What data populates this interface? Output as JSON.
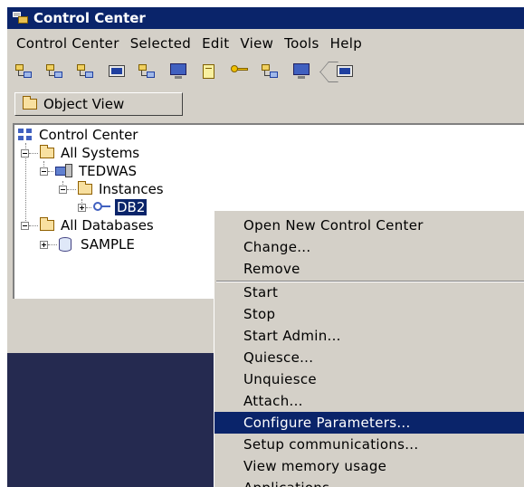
{
  "window": {
    "title": "Control Center"
  },
  "menubar": {
    "items": [
      "Control Center",
      "Selected",
      "Edit",
      "View",
      "Tools",
      "Help"
    ]
  },
  "toolbar": {
    "icons": [
      "system-tree-icon",
      "network-icon",
      "object-tree-icon",
      "command-center-icon",
      "replication-icon",
      "monitor-window-icon",
      "notes-icon",
      "key-icon",
      "connections-icon",
      "display-icon",
      "separator-icon",
      "command-icon"
    ]
  },
  "object_view": {
    "tab_label": "Object View"
  },
  "tree": {
    "root": "Control Center",
    "all_systems": "All Systems",
    "system": "TEDWAS",
    "instances": "Instances",
    "instance": "DB2",
    "all_databases": "All Databases",
    "database": "SAMPLE"
  },
  "context_menu": {
    "items": [
      "Open New Control Center",
      "Change...",
      "Remove",
      "Start",
      "Stop",
      "Start Admin...",
      "Quiesce...",
      "Unquiesce",
      "Attach...",
      "Configure Parameters...",
      "Setup communications...",
      "View memory usage",
      "Applications"
    ],
    "highlighted": "Configure Parameters..."
  },
  "colors": {
    "title_bar": "#0a246a",
    "selection": "#0a246a",
    "face": "#d4d0c8",
    "workspace": "#252a50"
  }
}
